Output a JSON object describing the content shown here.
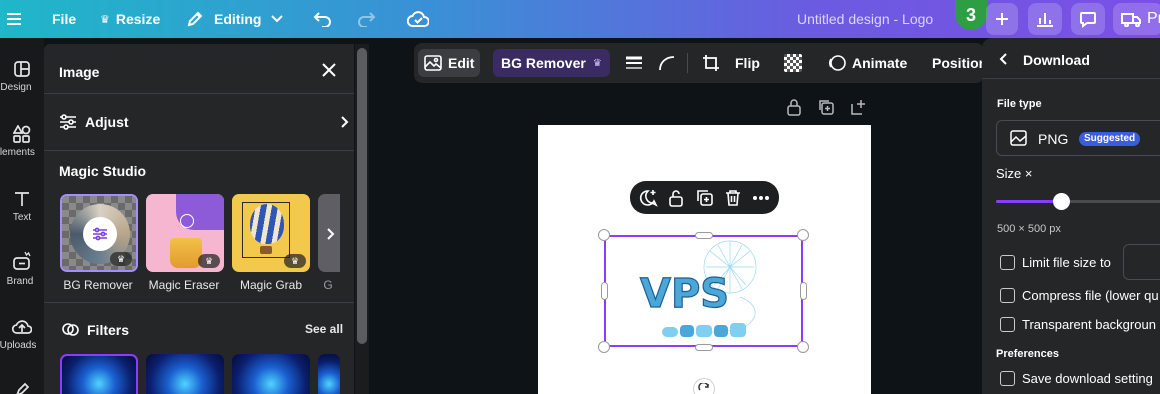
{
  "topbar": {
    "file_label": "File",
    "resize_label": "Resize",
    "editing_label": "Editing",
    "design_title": "Untitled design - Logo",
    "avatar_text": "3",
    "share_label": "Pr"
  },
  "rail": {
    "items": [
      {
        "label": "Design",
        "icon": "layout-icon"
      },
      {
        "label": "Elements",
        "icon": "shapes-icon"
      },
      {
        "label": "Text",
        "icon": "text-icon"
      },
      {
        "label": "Brand",
        "icon": "brand-icon"
      },
      {
        "label": "Uploads",
        "icon": "upload-icon"
      }
    ]
  },
  "image_panel": {
    "title": "Image",
    "adjust_label": "Adjust",
    "magic_studio_title": "Magic Studio",
    "tools": [
      {
        "label": "BG Remover"
      },
      {
        "label": "Magic Eraser"
      },
      {
        "label": "Magic Grab"
      },
      {
        "label": "G"
      }
    ],
    "filters_title": "Filters",
    "see_all_label": "See all"
  },
  "toolbar": {
    "edit_label": "Edit",
    "bg_remover_label": "BG Remover",
    "flip_label": "Flip",
    "animate_label": "Animate",
    "position_label": "Position"
  },
  "canvas": {
    "logo_text": "VPS"
  },
  "download": {
    "title": "Download",
    "file_type_label": "File type",
    "file_type_value": "PNG",
    "suggested_badge": "Suggested",
    "size_label": "Size ×",
    "size_value_text": "500 × 500 px",
    "size_slider_fraction": 0.5,
    "options": [
      {
        "label": "Limit file size to"
      },
      {
        "label": "Compress file (lower qu"
      },
      {
        "label": "Transparent backgroun"
      }
    ],
    "preferences_label": "Preferences",
    "save_settings_label": "Save download setting"
  },
  "colors": {
    "accent_purple": "#8b3dff",
    "badge_blue": "#3c5ce0",
    "avatar_green": "#2e9e44"
  }
}
